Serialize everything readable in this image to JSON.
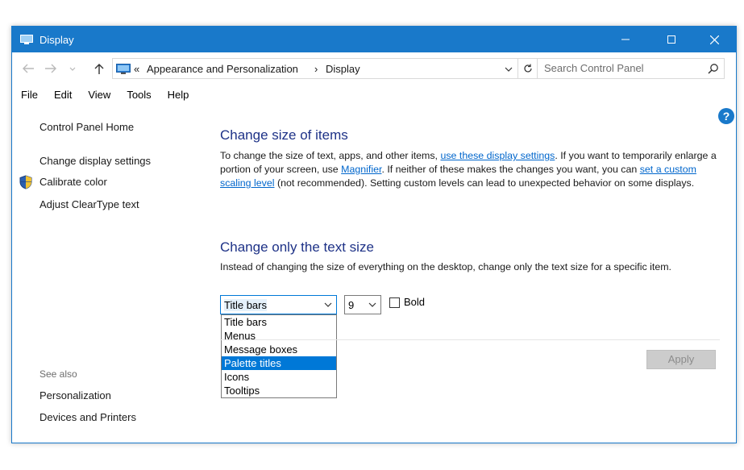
{
  "window": {
    "title": "Display",
    "accent": "#1979ca"
  },
  "address": {
    "overflow": "«",
    "crumbs": [
      "Appearance and Personalization",
      "Display"
    ],
    "separator": "›"
  },
  "search": {
    "placeholder": "Search Control Panel"
  },
  "menubar": [
    "File",
    "Edit",
    "View",
    "Tools",
    "Help"
  ],
  "sidebar": {
    "home": "Control Panel Home",
    "links": [
      "Change display settings",
      "Calibrate color",
      "Adjust ClearType text"
    ],
    "see_also_heading": "See also",
    "see_also": [
      "Personalization",
      "Devices and Printers"
    ]
  },
  "help_label": "?",
  "size_section": {
    "heading": "Change size of items",
    "t1": "To change the size of text, apps, and other items, ",
    "link1": "use these display settings",
    "t2": ".  If you want to temporarily enlarge a portion of your screen, use ",
    "link2": "Magnifier",
    "t3": ".  If neither of these makes the changes you want, you can ",
    "link3": "set a custom scaling level",
    "t4": " (not recommended).  Setting custom levels can lead to unexpected behavior on some displays."
  },
  "text_section": {
    "heading": "Change only the text size",
    "description": "Instead of changing the size of everything on the desktop, change only the text size for a specific item."
  },
  "item_select": {
    "value": "Title bars",
    "options": [
      "Title bars",
      "Menus",
      "Message boxes",
      "Palette titles",
      "Icons",
      "Tooltips"
    ],
    "highlighted": "Palette titles"
  },
  "size_select": {
    "value": "9"
  },
  "bold_label": "Bold",
  "apply_label": "Apply"
}
